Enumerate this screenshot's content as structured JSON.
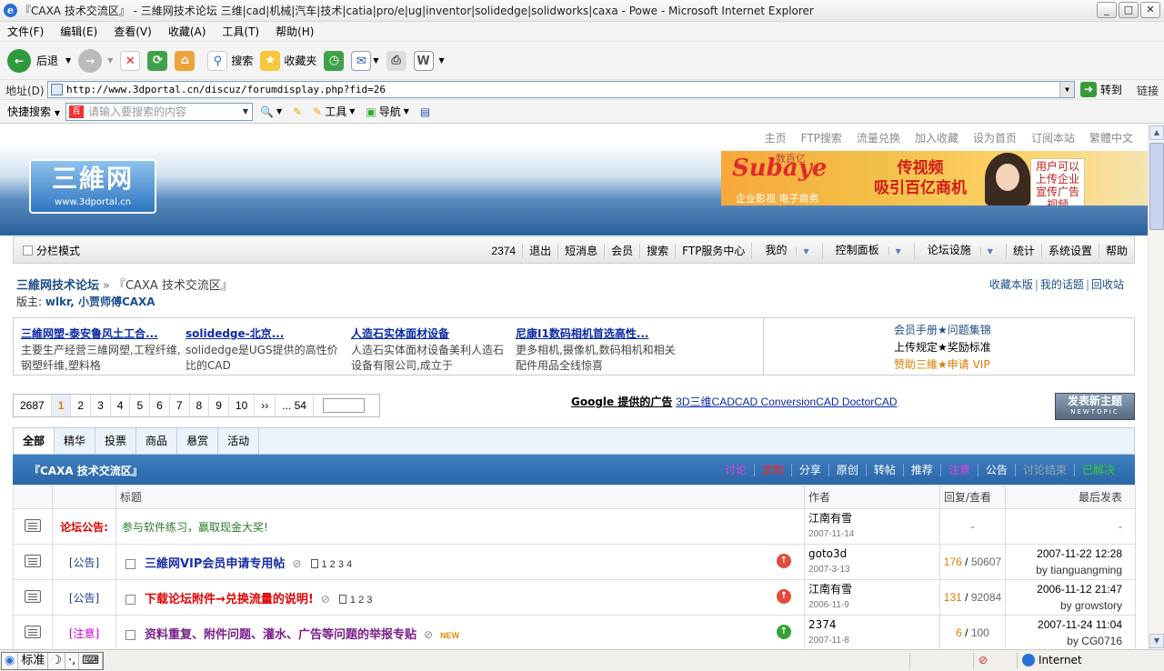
{
  "window": {
    "title": "『CAXA 技术交流区』 - 三維网技术论坛 三维|cad|机械|汽车|技术|catia|pro/e|ug|inventor|solidedge|solidworks|caxa - Powe - Microsoft Internet Explorer"
  },
  "menu": [
    "文件(F)",
    "编辑(E)",
    "查看(V)",
    "收藏(A)",
    "工具(T)",
    "帮助(H)"
  ],
  "toolbar": {
    "back": "后退",
    "search": "搜索",
    "favorites": "收藏夹"
  },
  "address": {
    "label": "地址(D)",
    "url": "http://www.3dportal.cn/discuz/forumdisplay.php?fid=26",
    "go": "转到",
    "links": "链接"
  },
  "searchbar": {
    "quick": "快捷搜索",
    "placeholder": "请输入要搜索的内容",
    "tools": "工具",
    "nav": "导航"
  },
  "site": {
    "toplinks": [
      "主页",
      "FTP搜索",
      "流量兑换",
      "加入收藏",
      "设为首页",
      "订阅本站",
      "繁體中文"
    ],
    "logo_cn": "三維网",
    "logo_url": "www.3dportal.cn",
    "banner": {
      "brand": "Subaye",
      "brand_top": "数百亿",
      "tag": "企业影视 电子商务",
      "headline1": "传视频",
      "headline2": "吸引百亿商机",
      "side": "用户可以上传企业宣传广告视频"
    }
  },
  "nav": {
    "split_mode": "分栏模式",
    "items": [
      "2374",
      "退出",
      "短消息",
      "会员",
      "搜索",
      "FTP服务中心",
      "我的",
      "控制面板",
      "论坛设施",
      "统计",
      "系统设置",
      "帮助"
    ]
  },
  "breadcrumb": {
    "home": "三維网技术论坛",
    "sep": "»",
    "current": "『CAXA 技术交流区』",
    "moderators_label": "版主:",
    "moderators": "wlkr, 小贾师傅CAXA"
  },
  "right_links": [
    "收藏本版",
    "我的话题",
    "回收站"
  ],
  "ads": [
    {
      "title": "三維网塑-泰安鲁风土工合...",
      "desc": "主要生产经营三維网塑,工程纤维,钢塑纤维,塑料格"
    },
    {
      "title": "solidedge-北京...",
      "desc": "solidedge是UGS提供的高性价比的CAD"
    },
    {
      "title": "人造石实体面材设备",
      "desc": "人造石实体面材设备美利人造石设备有限公司,成立于"
    },
    {
      "title": "尼康I1数码相机首选高性...",
      "desc": "更多相机,摄像机,数码相机和相关配件用品全线惊喜"
    }
  ],
  "ad_right": {
    "line1": "会员手册★问题集锦",
    "line2": "上传规定★奖励标准",
    "line3": "赞助三維★申请  VIP"
  },
  "pager": {
    "total": "2687",
    "pages": [
      "1",
      "2",
      "3",
      "4",
      "5",
      "6",
      "7",
      "8",
      "9",
      "10",
      "››",
      "... 54"
    ],
    "current": "1"
  },
  "google_ads": {
    "label": "Google 提供的广告",
    "links": "3D三维CADCAD ConversionCAD DoctorCAD"
  },
  "new_topic": {
    "label": "发表新主题",
    "sub": "NEWTOPIC"
  },
  "tabs": [
    "全部",
    "精华",
    "投票",
    "商品",
    "悬赏",
    "活动"
  ],
  "forum": {
    "name": "『CAXA 技术交流区』",
    "cats": [
      {
        "label": "讨论",
        "color": "#e040e0"
      },
      {
        "label": "求助",
        "color": "#ff2020"
      },
      {
        "label": "分享",
        "color": "#ffffff"
      },
      {
        "label": "原创",
        "color": "#ffffff"
      },
      {
        "label": "转帖",
        "color": "#ffffff"
      },
      {
        "label": "推荐",
        "color": "#ffffff"
      },
      {
        "label": "注意",
        "color": "#e040e0"
      },
      {
        "label": "公告",
        "color": "#ffffff"
      },
      {
        "label": "讨论结束",
        "color": "#9aa4b0"
      },
      {
        "label": "已解决",
        "color": "#33cc33"
      }
    ]
  },
  "table": {
    "headers": {
      "title": "标题",
      "author": "作者",
      "replies": "回复/查看",
      "last": "最后发表"
    },
    "announce": {
      "label": "论坛公告:",
      "text": "参与软件练习，赢取现金大奖!",
      "author": "江南有雪",
      "date": "2007-11-14",
      "replies": "-",
      "last": "-"
    },
    "rows": [
      {
        "type": "[公告]",
        "type_color": "#1a3d8f",
        "title": "三維网VIP会员申请专用帖",
        "title_color": "#1a2fa8",
        "pages": "1  2  3  4",
        "new": "",
        "author": "goto3d",
        "date": "2007-3-13",
        "replies": "176",
        "views": "50607",
        "last_date": "2007-11-22 12:28",
        "last_by": "tianguangming",
        "hot_color": "#e14b3b"
      },
      {
        "type": "[公告]",
        "type_color": "#1a3d8f",
        "title": "下载论坛附件→兑换流量的说明!",
        "title_color": "#e00000",
        "pages": "1  2  3",
        "new": "",
        "author": "江南有雪",
        "date": "2006-11-9",
        "replies": "131",
        "views": "92084",
        "last_date": "2006-11-12 21:47",
        "last_by": "growstory",
        "hot_color": "#e14b3b"
      },
      {
        "type": "[注意]",
        "type_color": "#d000d0",
        "title": "资料重复、附件问题、灌水、广告等问题的举报专贴",
        "title_color": "#7a1f8a",
        "pages": "",
        "new": "NEW",
        "author": "2374",
        "date": "2007-11-8",
        "replies": "6",
        "views": "100",
        "last_date": "2007-11-24 11:04",
        "last_by": "CG0716",
        "hot_color": "#3aa03a"
      }
    ]
  },
  "status": {
    "ime": "标准",
    "zone": "Internet"
  }
}
